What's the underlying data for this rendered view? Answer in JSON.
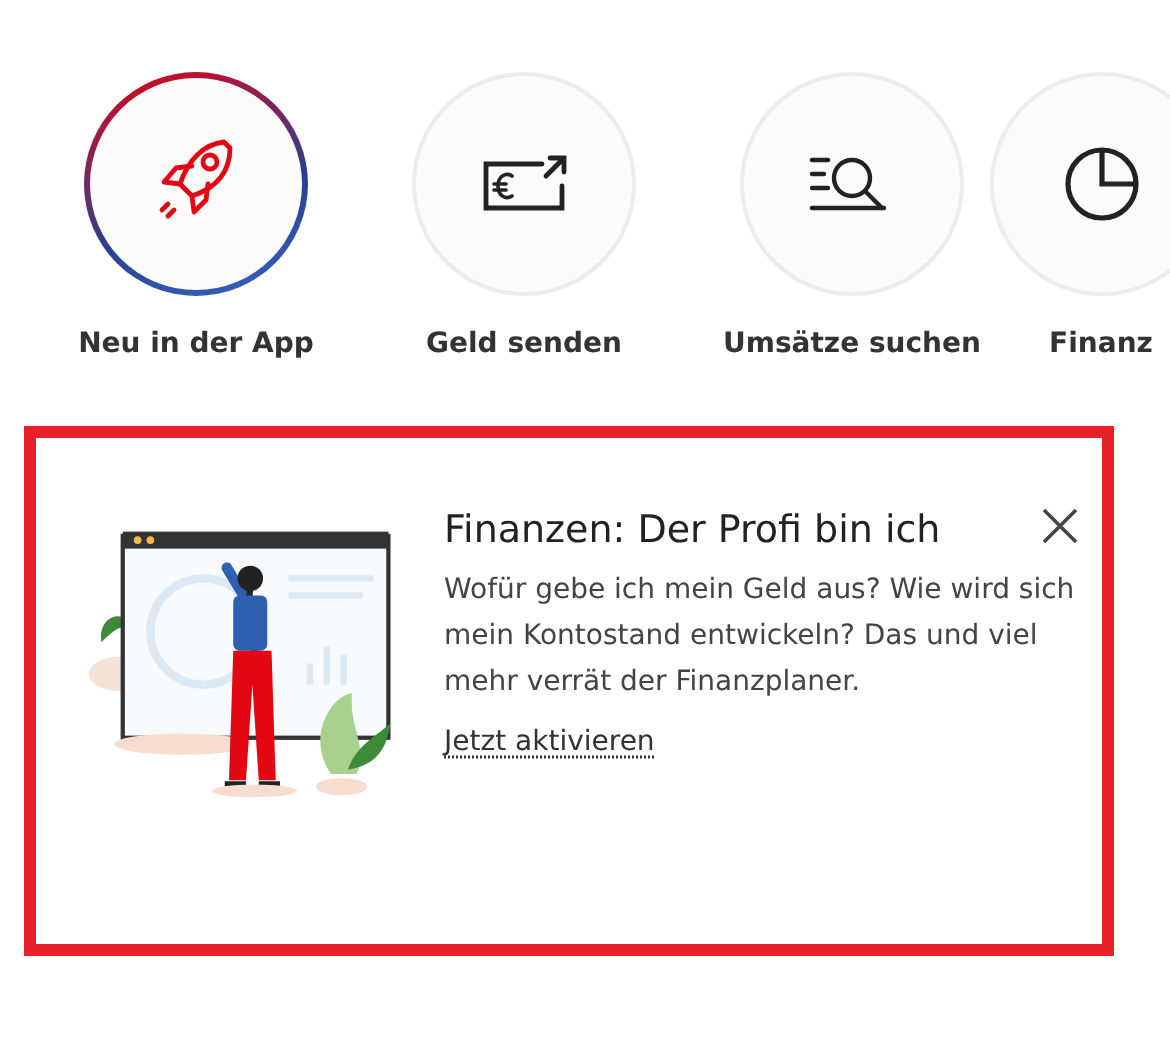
{
  "quick_actions": [
    {
      "label": "Neu in der App",
      "kind": "rocket",
      "highlighted": true
    },
    {
      "label": "Geld senden",
      "kind": "send-money",
      "highlighted": false
    },
    {
      "label": "Umsätze suchen",
      "kind": "search",
      "highlighted": false
    },
    {
      "label": "Finanz",
      "kind": "chart",
      "highlighted": false
    }
  ],
  "promo_card": {
    "title": "Finanzen: Der Profi bin ich",
    "text": "Wofür gebe ich mein Geld aus? Wie wird sich mein Kontostand entwickeln? Das und viel mehr verrät der Finanzplaner.",
    "link": "Jetzt aktivieren",
    "highlighted": true
  }
}
